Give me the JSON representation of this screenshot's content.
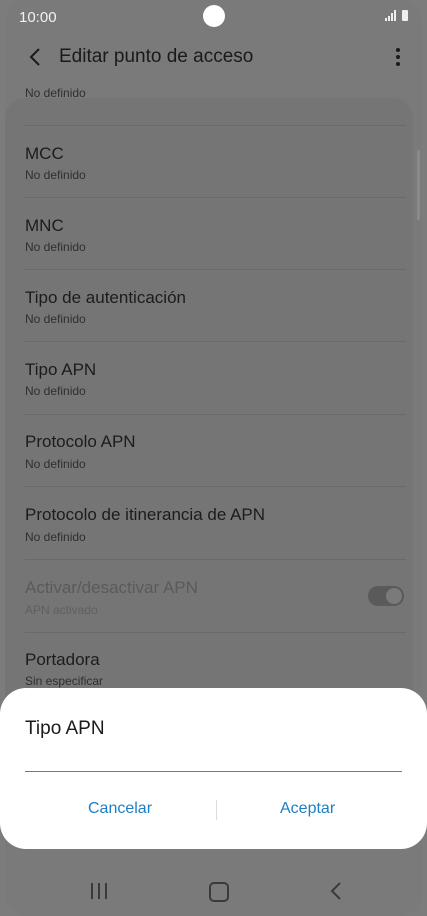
{
  "status_bar": {
    "time": "10:00"
  },
  "app_bar": {
    "title": "Editar punto de acceso"
  },
  "list": {
    "top_partial_value": "No definido",
    "items": [
      {
        "label": "MCC",
        "value": "No definido"
      },
      {
        "label": "MNC",
        "value": "No definido"
      },
      {
        "label": "Tipo de autenticación",
        "value": "No definido"
      },
      {
        "label": "Tipo APN",
        "value": "No definido"
      },
      {
        "label": "Protocolo APN",
        "value": "No definido"
      },
      {
        "label": "Protocolo de itinerancia de APN",
        "value": "No definido"
      },
      {
        "label": "Activar/desactivar APN",
        "value": "APN activado",
        "toggle_on": true,
        "disabled": true
      },
      {
        "label": "Portadora",
        "value": "Sin especificar"
      }
    ]
  },
  "dialog": {
    "title": "Tipo APN",
    "input_value": "",
    "cancel_label": "Cancelar",
    "accept_label": "Aceptar",
    "accent_color": "#1e7fc5"
  },
  "nav_bar": {
    "recents": "recents-icon",
    "home": "home-icon",
    "back": "back-icon"
  }
}
